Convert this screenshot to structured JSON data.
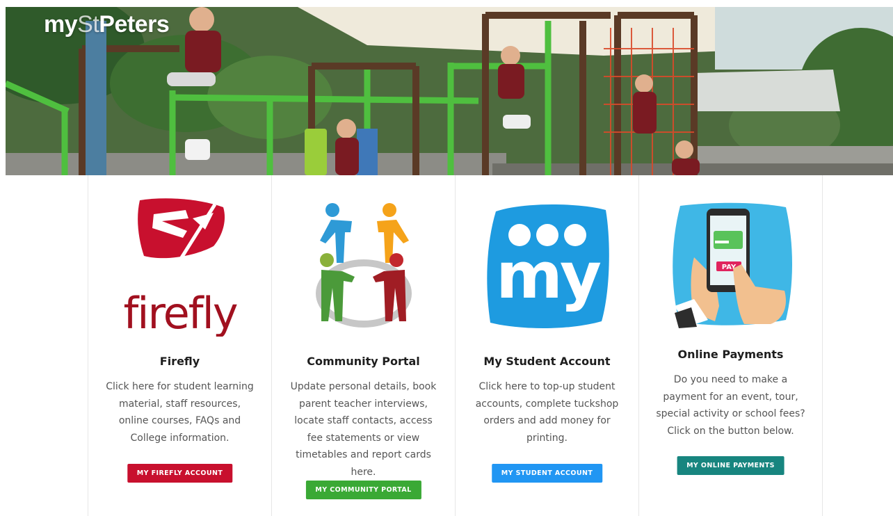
{
  "header": {
    "brand_prefix": "my",
    "brand_mid": "St",
    "brand_suffix": "Peters"
  },
  "cards": [
    {
      "title": "Firefly",
      "description": "Click here for student learning material, staff resources, online courses, FAQs and College information.",
      "button_label": "MY FIREFLY ACCOUNT",
      "button_color": "#c8102e",
      "logo_icon": "firefly-logo-icon",
      "logo_text": "firefly"
    },
    {
      "title": "Community Portal",
      "description": "Update personal details, book parent teacher interviews, locate staff contacts, access fee statements or view timetables and report cards here.",
      "button_label": "MY COMMUNITY PORTAL",
      "button_color": "#3aa935",
      "logo_icon": "community-people-circle-icon"
    },
    {
      "title": "My Student Account",
      "description": "Click here to top-up student accounts, complete tuckshop orders and add money for printing.",
      "button_label": "MY STUDENT ACCOUNT",
      "button_color": "#2196f3",
      "logo_icon": "my-student-account-logo-icon",
      "logo_text": "my"
    },
    {
      "title": "Online Payments",
      "description": "Do you need to make a payment for an event, tour, special activity or school fees? Click on the button below.",
      "button_label": "MY ONLINE PAYMENTS",
      "button_color": "#17857f",
      "logo_icon": "phone-pay-icon",
      "logo_text": "PAY"
    }
  ]
}
